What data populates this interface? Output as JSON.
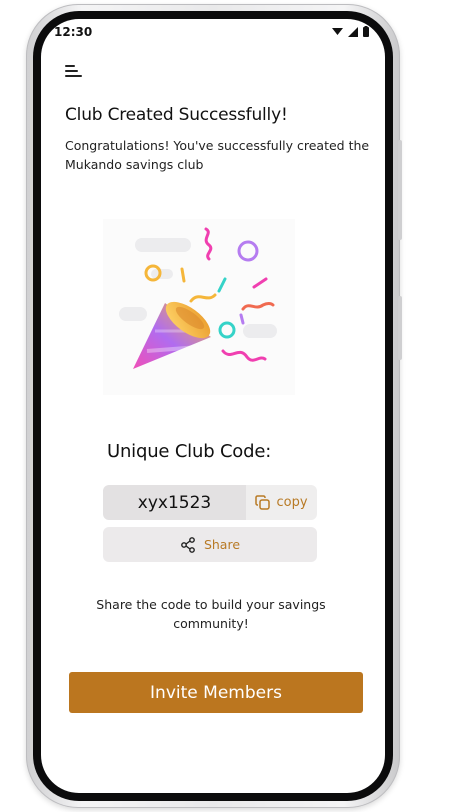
{
  "status_bar": {
    "time": "12:30",
    "icons": [
      "wifi-icon",
      "signal-icon",
      "battery-icon"
    ]
  },
  "header": {
    "menu_icon": "menu-icon"
  },
  "main": {
    "title": "Club Created Successfully!",
    "subtitle": "Congratulations! You've successfully created the Mukando savings club",
    "illustration": "party-popper-illustration",
    "code_label": "Unique Club Code:",
    "code_value": "xyx1523",
    "copy_label": "copy",
    "share_label": "Share",
    "hint": "Share the code to build your savings community!",
    "invite_label": "Invite Members"
  },
  "colors": {
    "accent": "#bb761f",
    "accent_text": "#b87a25",
    "code_bg": "#e3e1e2",
    "button_bg": "#eceaeb"
  }
}
